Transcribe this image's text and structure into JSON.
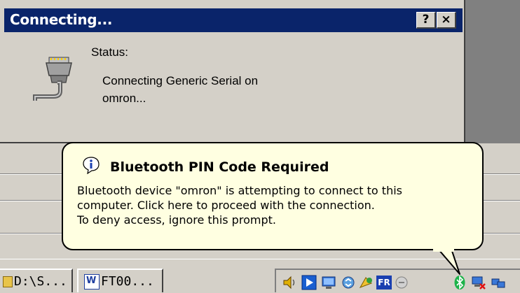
{
  "dialog": {
    "title": "Connecting...",
    "help_button": "?",
    "close_button": "×",
    "status_label": "Status:",
    "status_lines": [
      "Connecting Generic Serial on",
      "omron..."
    ],
    "icon": "serial-port-icon"
  },
  "balloon": {
    "icon": "info-icon",
    "title": "Bluetooth PIN Code Required",
    "lines": [
      "Bluetooth device \"omron\" is attempting to connect to this",
      "computer.  Click here to proceed with the connection.",
      "To deny access, ignore this prompt."
    ]
  },
  "taskbar": {
    "buttons": [
      {
        "label": "D:\\S...",
        "icon": "folder-icon"
      },
      {
        "label": "FT00...",
        "icon": "word-document-icon"
      }
    ],
    "tray": {
      "language": "FR",
      "icons": [
        "volume-icon",
        "media-player-icon",
        "network-icon",
        "sync-icon",
        "messenger-icon",
        "language-icon",
        "disabled-icon",
        "bluetooth-icon",
        "network-disconnected-icon",
        "network-connections-icon"
      ]
    }
  },
  "colors": {
    "titlebar": "#0a246a",
    "face": "#d4d0c8",
    "balloon": "#ffffe1",
    "bluetooth": "#1db34a"
  }
}
